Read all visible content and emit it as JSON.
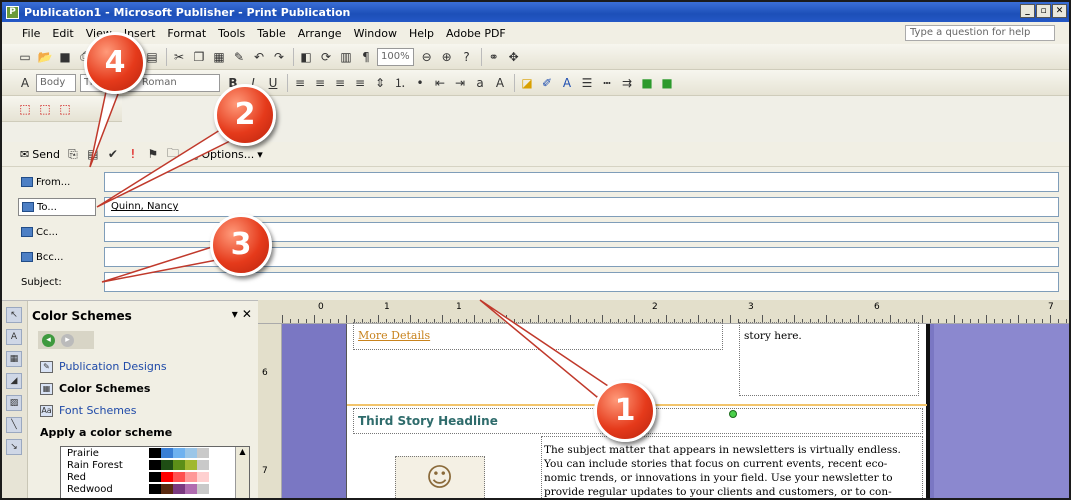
{
  "window": {
    "title": "Publication1 - Microsoft Publisher - Print Publication"
  },
  "menus": [
    "File",
    "Edit",
    "View",
    "Insert",
    "Format",
    "Tools",
    "Table",
    "Arrange",
    "Window",
    "Help",
    "Adobe PDF"
  ],
  "help": {
    "placeholder": "Type a question for help"
  },
  "toolbar": {
    "zoom": "100%",
    "style_box": "Body",
    "font_box": "Times New Roman"
  },
  "mailbar": {
    "send_label": "Send",
    "options_label": "Options..."
  },
  "fields": {
    "from_label": "From...",
    "to_label": "To...",
    "to_value": "Quinn, Nancy",
    "cc_label": "Cc...",
    "bcc_label": "Bcc...",
    "subject_label": "Subject:",
    "subject_value": ""
  },
  "taskpane": {
    "title": "Color Schemes",
    "links": [
      "Publication Designs",
      "Color Schemes",
      "Font Schemes"
    ],
    "apply_label": "Apply a color scheme",
    "schemes": [
      {
        "name": "Prairie",
        "colors": [
          "#000000",
          "#3a7fd5",
          "#6fb2f0",
          "#9bc6e8",
          "#c9c9c9"
        ]
      },
      {
        "name": "Rain Forest",
        "colors": [
          "#000000",
          "#1e4d14",
          "#5c8f18",
          "#a0b830",
          "#c9c9c9"
        ]
      },
      {
        "name": "Red",
        "colors": [
          "#000000",
          "#ff0000",
          "#ff5050",
          "#ff9898",
          "#ffd0d0"
        ]
      },
      {
        "name": "Redwood",
        "colors": [
          "#000000",
          "#5a2a10",
          "#7a3a80",
          "#b06cb0",
          "#c9c9c9"
        ]
      }
    ]
  },
  "ruler": {
    "top_numbers": [
      "0",
      "1",
      "1",
      "2",
      "3",
      "6",
      "7"
    ],
    "left_numbers": [
      "6",
      "7"
    ]
  },
  "document": {
    "more_details": "More Details",
    "story_here": "story here.",
    "headline": "Third Story Headline",
    "body_lines": [
      "The subject matter that appears in newsletters is virtually endless.",
      "You can include stories that focus on current events, recent eco-",
      "nomic trends, or innovations in your field. Use your newsletter to",
      "provide regular updates to your clients and customers, or to con-"
    ]
  },
  "callouts": [
    "1",
    "2",
    "3",
    "4"
  ]
}
